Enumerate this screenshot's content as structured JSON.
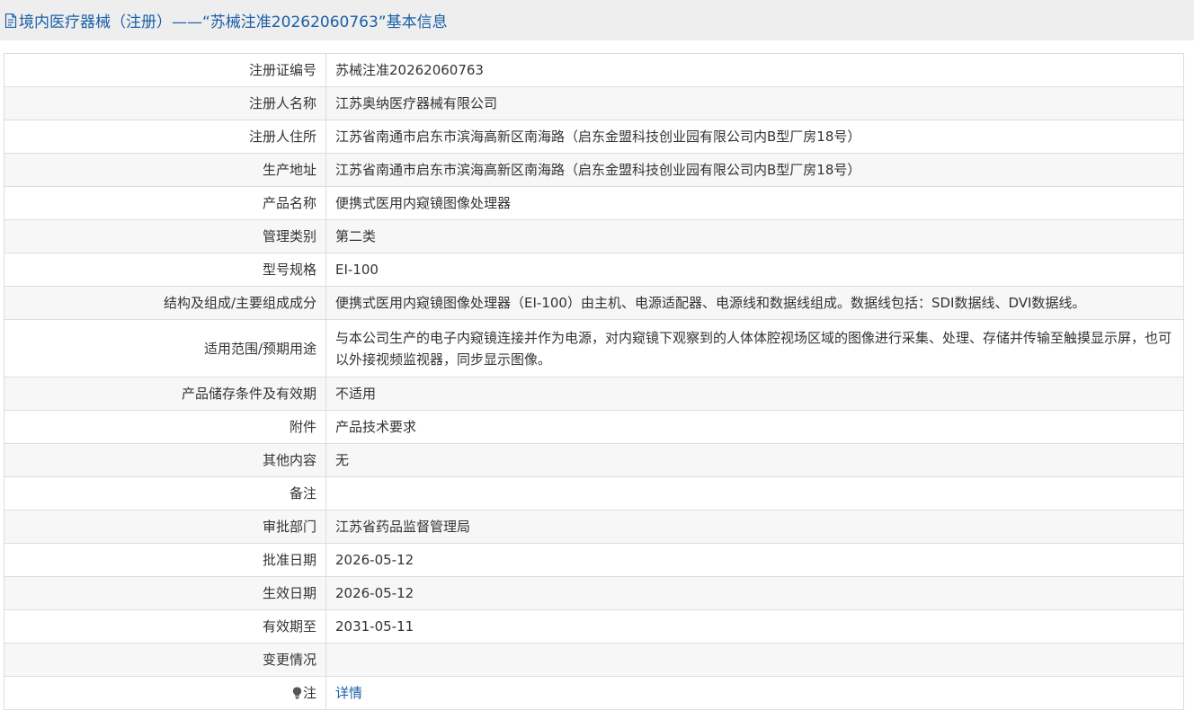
{
  "header": {
    "title": "境内医疗器械（注册）——“苏械注准20262060763”基本信息"
  },
  "rows": [
    {
      "label": "注册证编号",
      "value": "苏械注准20262060763"
    },
    {
      "label": "注册人名称",
      "value": "江苏奥纳医疗器械有限公司"
    },
    {
      "label": "注册人住所",
      "value": "江苏省南通市启东市滨海高新区南海路（启东金盟科技创业园有限公司内B型厂房18号）"
    },
    {
      "label": "生产地址",
      "value": "江苏省南通市启东市滨海高新区南海路（启东金盟科技创业园有限公司内B型厂房18号）"
    },
    {
      "label": "产品名称",
      "value": "便携式医用内窥镜图像处理器"
    },
    {
      "label": "管理类别",
      "value": "第二类"
    },
    {
      "label": "型号规格",
      "value": "EI-100"
    },
    {
      "label": "结构及组成/主要组成成分",
      "value": "便携式医用内窥镜图像处理器（EI-100）由主机、电源适配器、电源线和数据线组成。数据线包括：SDI数据线、DVI数据线。"
    },
    {
      "label": "适用范围/预期用途",
      "value": "与本公司生产的电子内窥镜连接并作为电源，对内窥镜下观察到的人体体腔视场区域的图像进行采集、处理、存储并传输至触摸显示屏，也可以外接视频监视器，同步显示图像。"
    },
    {
      "label": "产品储存条件及有效期",
      "value": "不适用"
    },
    {
      "label": "附件",
      "value": "产品技术要求"
    },
    {
      "label": "其他内容",
      "value": "无"
    },
    {
      "label": "备注",
      "value": ""
    },
    {
      "label": "审批部门",
      "value": "江苏省药品监督管理局"
    },
    {
      "label": "批准日期",
      "value": "2026-05-12"
    },
    {
      "label": "生效日期",
      "value": "2026-05-12"
    },
    {
      "label": "有效期至",
      "value": "2031-05-11"
    },
    {
      "label": "变更情况",
      "value": ""
    },
    {
      "label": "注",
      "value": "详情"
    }
  ],
  "colors": {
    "link": "#1a5fa8",
    "header_bg": "#eeeeee",
    "row_alt_bg": "#f7f7f7",
    "border": "#dddddd"
  },
  "icons": {
    "title_icon": "document-icon",
    "note_icon": "lightbulb-icon"
  }
}
